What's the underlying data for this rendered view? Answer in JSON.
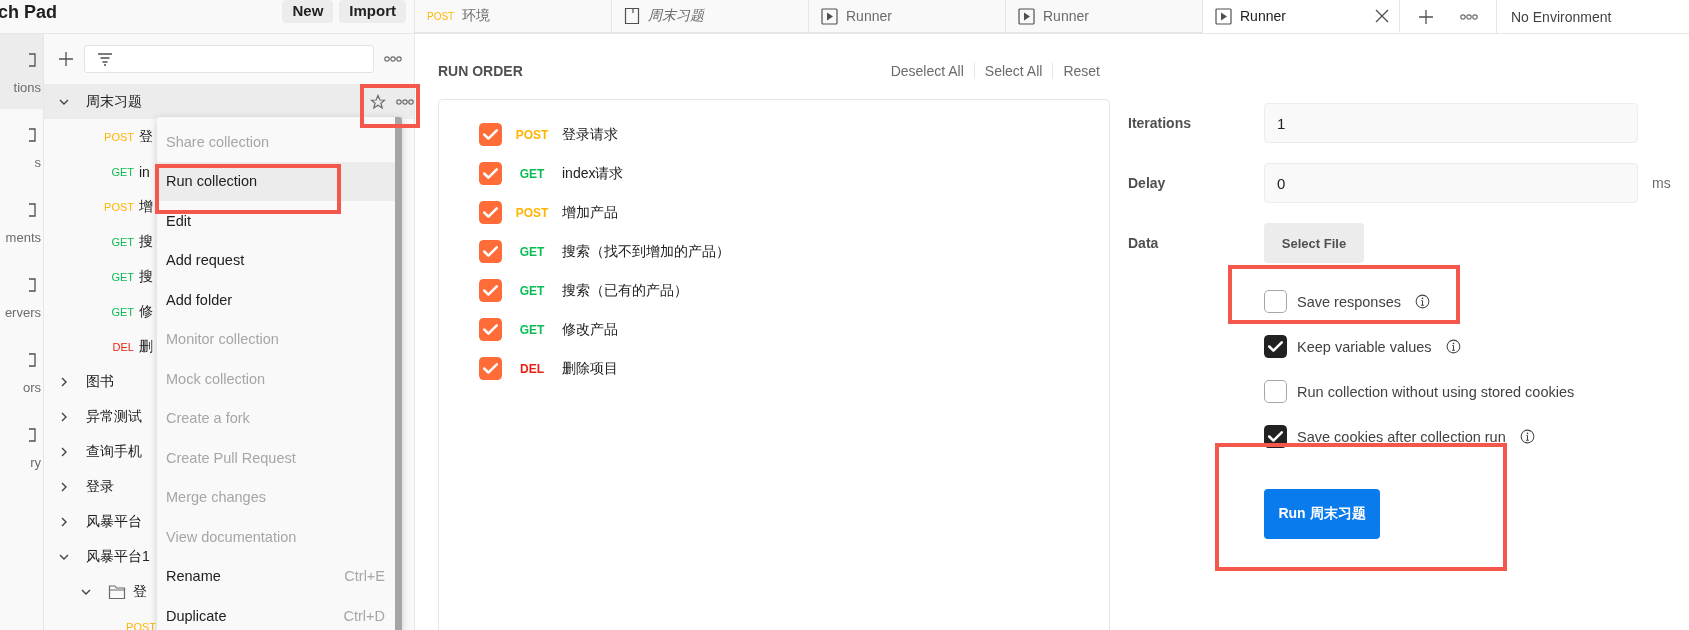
{
  "header": {
    "title": "ch Pad",
    "buttons": [
      "New",
      "Import"
    ]
  },
  "rail": [
    {
      "label": "tions",
      "selected": true
    },
    {
      "label": "s",
      "selected": false
    },
    {
      "label": "ments",
      "selected": false
    },
    {
      "label": "ervers",
      "selected": false
    },
    {
      "label": "ors",
      "selected": false
    },
    {
      "label": "ry",
      "selected": false
    }
  ],
  "tree": [
    {
      "kind": "collection",
      "name": "周末习题",
      "expanded": true,
      "selected": true,
      "children": [
        {
          "kind": "request",
          "method": "POST",
          "color": "#ffb400",
          "name": "登"
        },
        {
          "kind": "request",
          "method": "GET",
          "color": "#0cbb52",
          "name": "in"
        },
        {
          "kind": "request",
          "method": "POST",
          "color": "#ffb400",
          "name": "增"
        },
        {
          "kind": "request",
          "method": "GET",
          "color": "#0cbb52",
          "name": "搜"
        },
        {
          "kind": "request",
          "method": "GET",
          "color": "#0cbb52",
          "name": "搜"
        },
        {
          "kind": "request",
          "method": "GET",
          "color": "#0cbb52",
          "name": "修"
        },
        {
          "kind": "request",
          "method": "DEL",
          "color": "#eb2013",
          "name": "删"
        }
      ]
    },
    {
      "kind": "collection",
      "name": "图书",
      "expanded": false,
      "selected": false
    },
    {
      "kind": "collection",
      "name": "异常测试",
      "expanded": false,
      "selected": false
    },
    {
      "kind": "collection",
      "name": "查询手机",
      "expanded": false,
      "selected": false
    },
    {
      "kind": "collection",
      "name": "登录",
      "expanded": false,
      "selected": false
    },
    {
      "kind": "collection",
      "name": "风暴平台",
      "expanded": false,
      "selected": false
    },
    {
      "kind": "collection",
      "name": "风暴平台1",
      "expanded": true,
      "selected": false,
      "children": [
        {
          "kind": "folder",
          "name": "登",
          "expanded": true,
          "children": [
            {
              "kind": "request",
              "method": "POST",
              "color": "#ffb400"
            }
          ]
        }
      ]
    }
  ],
  "context_menu": [
    {
      "label": "Share collection",
      "disabled": true,
      "selected": false
    },
    {
      "label": "Run collection",
      "disabled": false,
      "selected": true
    },
    {
      "label": "Edit",
      "disabled": false,
      "selected": false
    },
    {
      "label": "Add request",
      "disabled": false,
      "selected": false
    },
    {
      "label": "Add folder",
      "disabled": false,
      "selected": false
    },
    {
      "label": "Monitor collection",
      "disabled": true,
      "selected": false
    },
    {
      "label": "Mock collection",
      "disabled": true,
      "selected": false
    },
    {
      "label": "Create a fork",
      "disabled": true,
      "selected": false
    },
    {
      "label": "Create Pull Request",
      "disabled": true,
      "selected": false
    },
    {
      "label": "Merge changes",
      "disabled": true,
      "selected": false
    },
    {
      "label": "View documentation",
      "disabled": true,
      "selected": false
    },
    {
      "label": "Rename",
      "shortcut": "Ctrl+E",
      "disabled": false,
      "selected": false
    },
    {
      "label": "Duplicate",
      "shortcut": "Ctrl+D",
      "disabled": false,
      "selected": false
    }
  ],
  "tabs": [
    {
      "kind": "request",
      "method": "POST",
      "color": "#ffb400",
      "label": "环境",
      "preview": false,
      "selected": false
    },
    {
      "kind": "collection",
      "label": "周末习题",
      "preview": true,
      "selected": false
    },
    {
      "kind": "runner",
      "label": "Runner",
      "preview": false,
      "selected": false
    },
    {
      "kind": "runner",
      "label": "Runner",
      "preview": false,
      "selected": false
    },
    {
      "kind": "runner",
      "label": "Runner",
      "preview": false,
      "selected": true
    }
  ],
  "environment": "No Environment",
  "run_order": {
    "title": "RUN ORDER",
    "actions": [
      "Deselect All",
      "Select All",
      "Reset"
    ],
    "requests": [
      {
        "checked": true,
        "method": "POST",
        "color": "#ffb400",
        "name": "登录请求"
      },
      {
        "checked": true,
        "method": "GET",
        "color": "#0cbb52",
        "name": "index请求"
      },
      {
        "checked": true,
        "method": "POST",
        "color": "#ffb400",
        "name": "增加产品"
      },
      {
        "checked": true,
        "method": "GET",
        "color": "#0cbb52",
        "name": "搜索（找不到增加的产品）"
      },
      {
        "checked": true,
        "method": "GET",
        "color": "#0cbb52",
        "name": "搜索（已有的产品）"
      },
      {
        "checked": true,
        "method": "GET",
        "color": "#0cbb52",
        "name": "修改产品"
      },
      {
        "checked": true,
        "method": "DEL",
        "color": "#eb2013",
        "name": "删除项目"
      }
    ]
  },
  "settings": {
    "iterations": {
      "label": "Iterations",
      "value": "1"
    },
    "delay": {
      "label": "Delay",
      "value": "0",
      "unit": "ms"
    },
    "data": {
      "label": "Data",
      "button": "Select File"
    },
    "options": [
      {
        "label": "Save responses",
        "checked": false,
        "info": true
      },
      {
        "label": "Keep variable values",
        "checked": true,
        "info": true
      },
      {
        "label": "Run collection without using stored cookies",
        "checked": false,
        "info": false
      },
      {
        "label": "Save cookies after collection run",
        "checked": true,
        "info": true
      }
    ],
    "run_button": "Run 周末习题"
  }
}
